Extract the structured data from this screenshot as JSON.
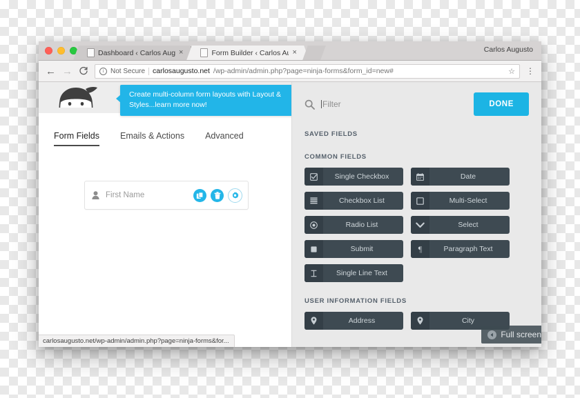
{
  "browser": {
    "traffic_lights": [
      "close",
      "minimize",
      "zoom"
    ],
    "tabs": [
      {
        "title": "Dashboard ‹ Carlos Augusto —",
        "active": false,
        "close_label": "×",
        "icon": "page-icon"
      },
      {
        "title": "Form Builder ‹ Carlos Augusto",
        "active": true,
        "close_label": "×",
        "icon": "page-icon"
      }
    ],
    "user_label": "Carlos Augusto",
    "nav": {
      "back": "←",
      "forward": "→",
      "reload": "C"
    },
    "omnibox": {
      "security_icon": "info-icon",
      "security_label": "Not Secure",
      "url_host": "carlosaugusto.net",
      "url_path": "/wp-admin/admin.php?page=ninja-forms&form_id=new#",
      "bookmark_icon": "star-icon",
      "menu_icon": "kebab-menu-icon"
    },
    "status_bar": "carlosaugusto.net/wp-admin/admin.php?page=ninja-forms&for..."
  },
  "notice": {
    "text": "Create multi-column form layouts with Layout & Styles...learn more now!",
    "color": "#22b5e8"
  },
  "builder": {
    "logo_name": "ninja-forms-logo",
    "tabs": [
      {
        "label": "Form Fields",
        "active": true
      },
      {
        "label": "Emails & Actions",
        "active": false
      },
      {
        "label": "Advanced",
        "active": false
      }
    ],
    "fields": [
      {
        "label": "First Name",
        "icon": "person-icon",
        "actions": [
          {
            "name": "duplicate-field-button",
            "icon": "copy-icon",
            "style": "fill"
          },
          {
            "name": "delete-field-button",
            "icon": "trash-icon",
            "style": "fill"
          },
          {
            "name": "field-settings-button",
            "icon": "gear-icon",
            "style": "ring"
          }
        ]
      }
    ]
  },
  "panel": {
    "filter": {
      "icon": "search-icon",
      "placeholder": "Filter",
      "value": ""
    },
    "done_label": "DONE",
    "accent": "#1cb4e4",
    "sections": [
      {
        "heading": "SAVED FIELDS",
        "items": []
      },
      {
        "heading": "COMMON FIELDS",
        "items": [
          {
            "label": "Single Checkbox",
            "icon": "checkbox-checked-icon"
          },
          {
            "label": "Date",
            "icon": "calendar-icon"
          },
          {
            "label": "Checkbox List",
            "icon": "list-icon"
          },
          {
            "label": "Multi-Select",
            "icon": "square-outline-icon"
          },
          {
            "label": "Radio List",
            "icon": "radio-icon"
          },
          {
            "label": "Select",
            "icon": "chevron-down-icon"
          },
          {
            "label": "Submit",
            "icon": "filled-square-icon"
          },
          {
            "label": "Paragraph Text",
            "icon": "pilcrow-icon"
          },
          {
            "label": "Single Line Text",
            "icon": "text-cursor-icon"
          }
        ]
      },
      {
        "heading": "USER INFORMATION FIELDS",
        "items": [
          {
            "label": "Address",
            "icon": "map-pin-icon"
          },
          {
            "label": "City",
            "icon": "map-pin-icon"
          }
        ]
      }
    ]
  },
  "overlay": {
    "label": "Full screen",
    "icon": "back-circle-icon"
  }
}
